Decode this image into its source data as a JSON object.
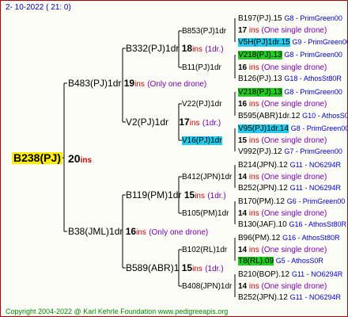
{
  "date": "2- 10-2022 ( 21: 0)",
  "root": {
    "label": "B238(PJ)",
    "ins": "20",
    "ins_unit": "ins"
  },
  "g1": [
    {
      "label": "B483(PJ)1dr",
      "ins": "19",
      "unit": "ins",
      "note": "(Only one drone)"
    },
    {
      "label": "B38(JML)1dr",
      "ins": "16",
      "unit": "ins",
      "note": "(Only one drone)"
    }
  ],
  "g2": [
    {
      "label": "B332(PJ)1dr",
      "ins": "18",
      "unit": "ins",
      "note": "(1dr.)"
    },
    {
      "label": "V2(PJ)1dr",
      "ins": "17",
      "unit": "ins",
      "note": "(1dr.)"
    },
    {
      "label": "B119(PM)1dr",
      "ins": "15",
      "unit": "ins",
      "note": "(1dr.)"
    },
    {
      "label": "B589(ABR)1",
      "ins": "15",
      "unit": "ins",
      "note": "(1dr.)"
    }
  ],
  "g3": [
    {
      "label": "B853(PJ)1dr",
      "ins": "17",
      "unit": "ins",
      "note": "(One single drone)"
    },
    {
      "label": "B11(PJ)1dr",
      "ins": "16",
      "unit": "ins",
      "note": "(One single drone)"
    },
    {
      "label": "V22(PJ)1dr",
      "ins": "16",
      "unit": "ins",
      "note": "(One single drone)"
    },
    {
      "label": "V16(PJ)1dr",
      "ins": "15",
      "unit": "ins",
      "note": "(One single drone)"
    },
    {
      "label": "B412(JPN)1dr",
      "ins": "14",
      "unit": "ins",
      "note": "(One single drone)"
    },
    {
      "label": "B105(PM)1dr",
      "ins": "14",
      "unit": "ins",
      "note": "(One single drone)"
    },
    {
      "label": "B102(RL)1dr",
      "ins": "14",
      "unit": "ins",
      "note": "(One single drone)"
    },
    {
      "label": "B408(JPN)1dr",
      "ins": "14",
      "unit": "ins",
      "note": "(One single drone)"
    }
  ],
  "g4": [
    {
      "label": "B197(PJ).15",
      "info": "G8 - PrimGreen00"
    },
    {
      "label": "V5H(PJ)1dr.15",
      "info": "G9 - PrimGreen00"
    },
    {
      "label": "V218(PJ).13",
      "info": "G8 - PrimGreen00"
    },
    {
      "label": "B126(PJ).13",
      "info": "G18 - AthosSt80R"
    },
    {
      "label": "V218(PJ).13",
      "info": "G8 - PrimGreen00"
    },
    {
      "label": "B595(ABR)1dr.12",
      "info": "G10 - AthosS0R"
    },
    {
      "label": "V95(PJ)1dr.14",
      "info": "G8 - PrimGreen00"
    },
    {
      "label": "V992(PJ).12",
      "info": "G7 - PrimGreen00"
    },
    {
      "label": "B214(JPN).12",
      "info": "G11 - NO6294R"
    },
    {
      "label": "B252(JPN).12",
      "info": "G11 - NO6294R"
    },
    {
      "label": "B170(PM).12",
      "info": "G6 - PrimGreen00"
    },
    {
      "label": "B130(JAF).10",
      "info": "G16 - AthosSt80R"
    },
    {
      "label": "B96(PM).12",
      "info": "G16 - AthosSt80R"
    },
    {
      "label": "T8(RL).09",
      "info": "G5 - AthosS0R"
    },
    {
      "label": "B210(BOP).12",
      "info": "G11 - NO6294R"
    },
    {
      "label": "B252(JPN).12",
      "info": "G11 - NO6294R"
    }
  ],
  "footer": "Copyright 2004-2022 @ Karl Kehrle Foundation     www.pedigreeapis.org",
  "colors": {
    "border": "#b00000",
    "lines": "#000000",
    "ins": "#cc0000",
    "highlight_root": "#ffee00",
    "highlight_green": "#22cc22",
    "highlight_cyan": "#22ccee"
  }
}
